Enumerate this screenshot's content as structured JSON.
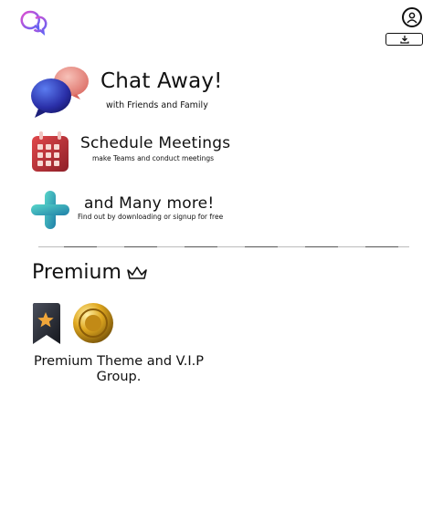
{
  "header": {
    "logo_icon": "chat-bubbles-logo",
    "profile_icon": "user-circle-icon",
    "download_icon": "download-icon"
  },
  "features": [
    {
      "title": "Chat Away!",
      "subtitle": "with Friends and Family",
      "icon": "speech-bubbles-3d"
    },
    {
      "title": "Schedule Meetings",
      "subtitle": "make Teams and conduct meetings",
      "icon": "calendar-3d"
    },
    {
      "title": "and Many more!",
      "subtitle": "Find out by downloading or signup for free",
      "icon": "plus-3d"
    }
  ],
  "premium": {
    "title": "Premium",
    "crown_icon": "crown-icon",
    "description": "Premium Theme and V.I.P Group.",
    "badge_icons": [
      "star-bookmark-3d",
      "gold-coin-3d"
    ]
  },
  "colors": {
    "logo_gradient_start": "#e14fd0",
    "logo_gradient_end": "#5b63f5",
    "text": "#111111"
  }
}
